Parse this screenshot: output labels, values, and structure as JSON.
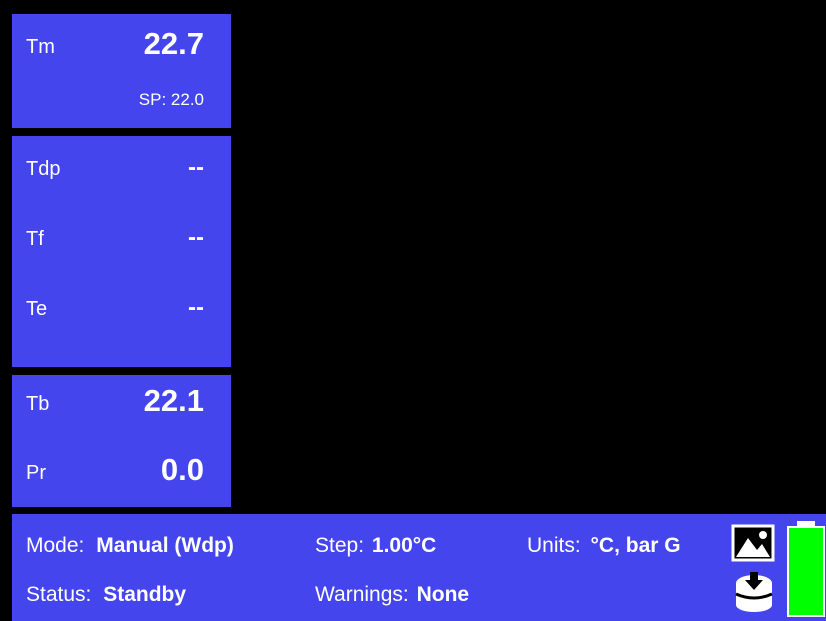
{
  "panels": {
    "tm": {
      "label": "Tm",
      "value": "22.7",
      "setpoint": "SP: 22.0"
    },
    "tdp": {
      "label": "Tdp",
      "value": "--"
    },
    "tf": {
      "label": "Tf",
      "value": "--"
    },
    "te": {
      "label": "Te",
      "value": "--"
    },
    "tb": {
      "label": "Tb",
      "value": "22.1"
    },
    "pr": {
      "label": "Pr",
      "value": "0.0"
    }
  },
  "status_bar": {
    "mode_label": "Mode:",
    "mode_value": "Manual (Wdp)",
    "step_label": "Step:",
    "step_value": "1.00°C",
    "units_label": "Units:",
    "units_value": "°C, bar G",
    "status_label": "Status:",
    "status_value": "Standby",
    "warnings_label": "Warnings:",
    "warnings_value": "None"
  },
  "icons": {
    "screenshot": "image-icon",
    "storage": "database-download-icon",
    "battery": "battery-icon"
  },
  "battery_level": 1.0,
  "colors": {
    "panel": "#4545ee",
    "background": "#000000",
    "battery": "#00ff00"
  }
}
